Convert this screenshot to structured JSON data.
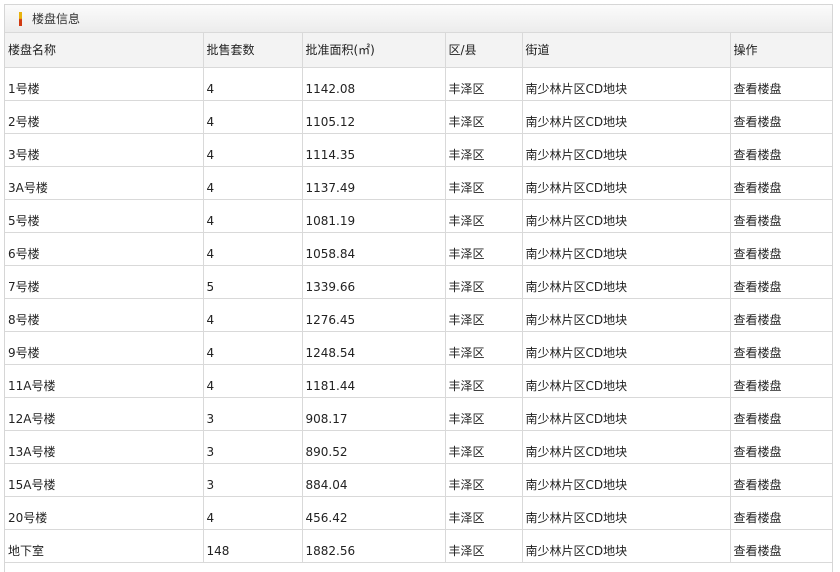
{
  "panel": {
    "title": "楼盘信息",
    "marker_colors": [
      "#e8b30e",
      "#d13a12"
    ]
  },
  "table": {
    "columns": [
      "楼盘名称",
      "批售套数",
      "批准面积(㎡)",
      "区/县",
      "街道",
      "操作"
    ],
    "rows": [
      {
        "name": "1号楼",
        "units": "4",
        "area": "1142.08",
        "district": "丰泽区",
        "street": "南少林片区CD地块",
        "action": "查看楼盘"
      },
      {
        "name": "2号楼",
        "units": "4",
        "area": "1105.12",
        "district": "丰泽区",
        "street": "南少林片区CD地块",
        "action": "查看楼盘"
      },
      {
        "name": "3号楼",
        "units": "4",
        "area": "1114.35",
        "district": "丰泽区",
        "street": "南少林片区CD地块",
        "action": "查看楼盘"
      },
      {
        "name": "3A号楼",
        "units": "4",
        "area": "1137.49",
        "district": "丰泽区",
        "street": "南少林片区CD地块",
        "action": "查看楼盘"
      },
      {
        "name": "5号楼",
        "units": "4",
        "area": "1081.19",
        "district": "丰泽区",
        "street": "南少林片区CD地块",
        "action": "查看楼盘"
      },
      {
        "name": "6号楼",
        "units": "4",
        "area": "1058.84",
        "district": "丰泽区",
        "street": "南少林片区CD地块",
        "action": "查看楼盘"
      },
      {
        "name": "7号楼",
        "units": "5",
        "area": "1339.66",
        "district": "丰泽区",
        "street": "南少林片区CD地块",
        "action": "查看楼盘"
      },
      {
        "name": "8号楼",
        "units": "4",
        "area": "1276.45",
        "district": "丰泽区",
        "street": "南少林片区CD地块",
        "action": "查看楼盘"
      },
      {
        "name": "9号楼",
        "units": "4",
        "area": "1248.54",
        "district": "丰泽区",
        "street": "南少林片区CD地块",
        "action": "查看楼盘"
      },
      {
        "name": "11A号楼",
        "units": "4",
        "area": "1181.44",
        "district": "丰泽区",
        "street": "南少林片区CD地块",
        "action": "查看楼盘"
      },
      {
        "name": "12A号楼",
        "units": "3",
        "area": "908.17",
        "district": "丰泽区",
        "street": "南少林片区CD地块",
        "action": "查看楼盘"
      },
      {
        "name": "13A号楼",
        "units": "3",
        "area": "890.52",
        "district": "丰泽区",
        "street": "南少林片区CD地块",
        "action": "查看楼盘"
      },
      {
        "name": "15A号楼",
        "units": "3",
        "area": "884.04",
        "district": "丰泽区",
        "street": "南少林片区CD地块",
        "action": "查看楼盘"
      },
      {
        "name": "20号楼",
        "units": "4",
        "area": "456.42",
        "district": "丰泽区",
        "street": "南少林片区CD地块",
        "action": "查看楼盘"
      },
      {
        "name": "地下室",
        "units": "148",
        "area": "1882.56",
        "district": "丰泽区",
        "street": "南少林片区CD地块",
        "action": "查看楼盘"
      }
    ]
  }
}
